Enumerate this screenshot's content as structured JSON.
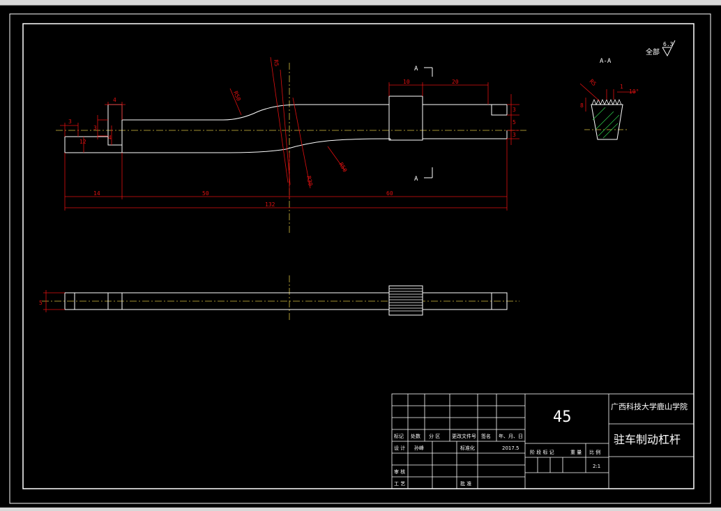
{
  "drawing": {
    "section_label": "A-A",
    "cut_label": "A",
    "roughness_prefix": "全部",
    "roughness_value": "6.3",
    "view_dims": {
      "d_3_left": "3",
      "d_4_top": "4",
      "d_3_side": "3",
      "d_12": "12",
      "d_4_side": "4",
      "d_14": "14",
      "d_50": "50",
      "d_60": "60",
      "d_132": "132",
      "r_r50_top": "R50",
      "r_r5": "R5",
      "r_r50_bottom": "R50",
      "r_r30": "R30",
      "d_10": "10",
      "d_20": "20",
      "d_3_r1": "3",
      "d_5_r": "5",
      "d_3_r2": "3",
      "d_5_side": "5"
    },
    "section_dims": {
      "r_small": "R5",
      "d_1": "1",
      "angle": "10°",
      "d_8": "8"
    }
  },
  "title_block": {
    "material": "45",
    "school": "广西科技大学鹿山学院",
    "part_name": "驻车制动杠杆",
    "row_labels": [
      "标记",
      "处数",
      "分 区",
      "更改文件号",
      "签名",
      "年、月、日"
    ],
    "design_label": "设 计",
    "designer": "孙峰",
    "standard_label": "标准化",
    "date": "2017.5",
    "review_label": "审 核",
    "process_label": "工 艺",
    "approve_label": "批 准",
    "stage_labels": [
      "阶 段 标 记",
      "重 量",
      "比 例"
    ],
    "scale": "2:1"
  }
}
